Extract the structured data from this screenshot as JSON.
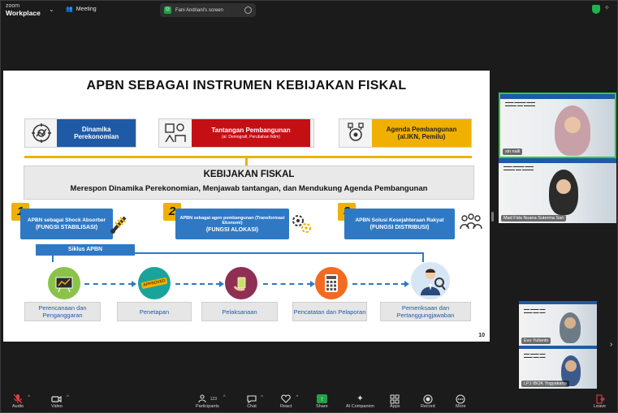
{
  "app": {
    "brand_line1": "zoom",
    "brand_line2": "Workplace",
    "meeting_label": "Meeting",
    "share_pill_text": "Fani Andriani's screen",
    "share_pill_badge": "G"
  },
  "slide": {
    "title": "APBN SEBAGAI INSTRUMEN KEBIJAKAN FISKAL",
    "top_boxes": [
      {
        "label": "Dinamika Perekonomian",
        "sub": "",
        "color": "#1f5aa6"
      },
      {
        "label": "Tantangan Pembangunan",
        "sub": "(al. Demografi, Perubahan Iklim)",
        "color": "#c40f14"
      },
      {
        "label": "Agenda Pembangunan (al.IKN, Pemilu)",
        "sub": "",
        "color": "#f0b000"
      }
    ],
    "kebijakan_title": "KEBIJAKAN FISKAL",
    "kebijakan_subtitle": "Merespon Dinamika Perekonomian, Menjawab tantangan, dan Mendukung Agenda Pembangunan",
    "functions": [
      {
        "number": "1",
        "line1": "APBN sebagai Shock Absorber",
        "line2": "(FUNGSI STABILISASI)"
      },
      {
        "number": "2",
        "line1": "APBN sebagai agen pembangunan (Transformasi Ekonomi)",
        "line2": "(FUNGSI ALOKASI)"
      },
      {
        "number": "3",
        "line1": "APBN Solusi Kesejahteraan Rakyat",
        "line2": "(FUNGSI DISTRIBUSI)"
      }
    ],
    "siklus_label": "Siklus APBN",
    "steps": [
      {
        "label": "Perencanaan dan Penganggaran",
        "icon_badge": ""
      },
      {
        "label": "Penetapan",
        "icon_badge": "APPROVED"
      },
      {
        "label": "Pelaksanaan",
        "icon_badge": ""
      },
      {
        "label": "Pencatatan dan Pelaporan",
        "icon_badge": ""
      },
      {
        "label": "Pemeriksaan dan Pertanggungjawaban",
        "icon_badge": ""
      }
    ],
    "page_number": "10"
  },
  "participants": [
    {
      "name": "sin naili",
      "active": true
    },
    {
      "name": "Mad Fida Nuana Suterma Sari",
      "active": false
    },
    {
      "name": "Evu Yulianto",
      "active": false
    },
    {
      "name": "LPJ IBOK Yogyakarta",
      "active": false
    }
  ],
  "toolbar": {
    "audio": "Audio",
    "video": "Video",
    "participants": "Participants",
    "participants_count": "123",
    "chat": "Chat",
    "react": "React",
    "share": "Share",
    "ai_companion": "AI Companion",
    "apps": "Apps",
    "record": "Record",
    "more": "More",
    "leave": "Leave"
  },
  "colors": {
    "blue": "#1f5aa6",
    "function_blue": "#2f79c4",
    "red": "#c40f14",
    "gold": "#f0b000",
    "share_green": "#24a148",
    "active_border": "#2ecc40"
  }
}
